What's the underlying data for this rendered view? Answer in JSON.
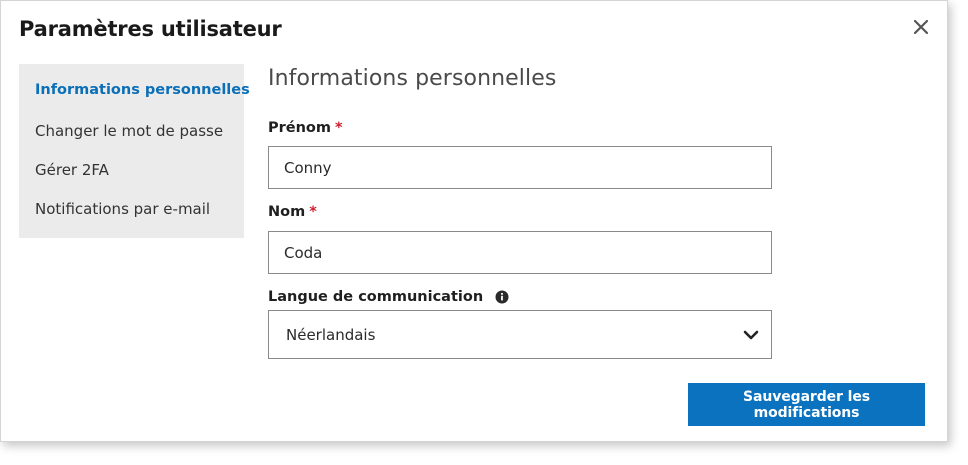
{
  "dialog": {
    "title": "Paramètres utilisateur",
    "close_icon": "close-icon"
  },
  "sidebar": {
    "items": [
      {
        "label": "Informations personnelles",
        "active": true
      },
      {
        "label": "Changer le mot de passe",
        "active": false
      },
      {
        "label": "Gérer 2FA",
        "active": false
      },
      {
        "label": "Notifications par e-mail",
        "active": false
      }
    ]
  },
  "main": {
    "section_title": "Informations personnelles",
    "first_name": {
      "label": "Prénom",
      "required_mark": "*",
      "value": "Conny"
    },
    "last_name": {
      "label": "Nom",
      "required_mark": "*",
      "value": "Coda"
    },
    "language": {
      "label": "Langue de communication",
      "info_icon": "info-icon",
      "selected": "Néerlandais",
      "chevron_icon": "chevron-down-icon"
    },
    "save_label": "Sauvegarder les modifications"
  },
  "colors": {
    "accent": "#0b72bf",
    "active_nav": "#0b6fb8",
    "required": "#cc1f2e",
    "sidebar_bg": "#ebebeb"
  }
}
